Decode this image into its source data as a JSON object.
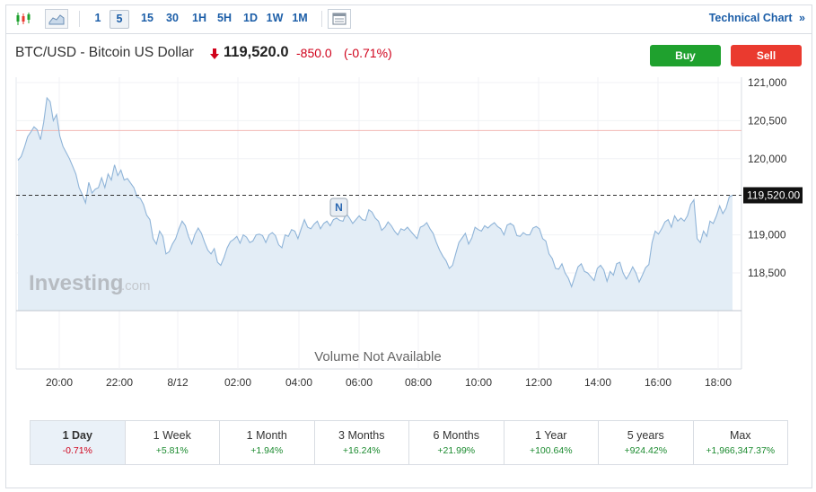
{
  "toolbar": {
    "chart_type_icon": "candlestick-icon",
    "area_icon": "area-chart-icon",
    "timeframes": [
      "1",
      "5",
      "15",
      "30",
      "1H",
      "5H",
      "1D",
      "1W",
      "1M"
    ],
    "active_timeframe": "5",
    "calendar_icon": "calendar-icon",
    "technical_chart": "Technical Chart",
    "technical_chart_arrow": "»"
  },
  "header": {
    "title": "BTC/USD - Bitcoin US Dollar",
    "price": "119,520.0",
    "change": "-850.0",
    "change_pct": "(-0.71%)",
    "direction_icon": "down-arrow-icon",
    "buy_label": "Buy",
    "sell_label": "Sell",
    "colors": {
      "buy": "#1fa12e",
      "sell": "#ea3a2f",
      "down": "#d0021b",
      "up": "#1a8a2e"
    }
  },
  "chart_data": {
    "type": "area",
    "y_ticks": [
      "121,000",
      "120,500",
      "120,000",
      "119,000",
      "118,500"
    ],
    "ylim": [
      118000,
      121200
    ],
    "x_ticks": [
      "20:00",
      "22:00",
      "8/12",
      "02:00",
      "04:00",
      "06:00",
      "08:00",
      "10:00",
      "12:00",
      "14:00",
      "16:00",
      "18:00"
    ],
    "current_price_label": "119,520.00",
    "current_price": 119520,
    "previous_close": 120370,
    "news_marker": "N",
    "watermark": "Investing",
    "watermark_suffix": ".com",
    "volume_text": "Volume Not Available",
    "series": [
      {
        "values": [
          119980,
          120030,
          120150,
          120290,
          120350,
          120420,
          120380,
          120250,
          120480,
          120800,
          120750,
          120500,
          120580,
          120300,
          120160,
          120080,
          120000,
          119900,
          119800,
          119620,
          119530,
          119420,
          119690,
          119550,
          119600,
          119620,
          119750,
          119620,
          119800,
          119720,
          119920,
          119780,
          119850,
          119720,
          119740,
          119680,
          119620,
          119500,
          119480,
          119400,
          119260,
          119200,
          118950,
          118880,
          119050,
          118980,
          118750,
          118780,
          118880,
          118950,
          119080,
          119180,
          119120,
          118980,
          118880,
          119010,
          119090,
          119020,
          118900,
          118800,
          118750,
          118820,
          118640,
          118600,
          118700,
          118830,
          118910,
          118940,
          118980,
          118890,
          119000,
          118970,
          118900,
          118920,
          119000,
          119010,
          118990,
          118900,
          119000,
          119030,
          118990,
          118870,
          118830,
          119000,
          118980,
          119070,
          119050,
          118950,
          119080,
          119200,
          119100,
          119080,
          119140,
          119180,
          119080,
          119150,
          119180,
          119120,
          119200,
          119220,
          119190,
          119180,
          119280,
          119220,
          119150,
          119200,
          119250,
          119200,
          119190,
          119330,
          119300,
          119220,
          119180,
          119060,
          119100,
          119170,
          119120,
          119050,
          119000,
          119080,
          119060,
          119100,
          119050,
          119000,
          118950,
          119100,
          119120,
          119160,
          119080,
          119020,
          118900,
          118800,
          118720,
          118660,
          118560,
          118600,
          118750,
          118900,
          118960,
          119020,
          118880,
          118960,
          119100,
          119070,
          119050,
          119120,
          119090,
          119130,
          119160,
          119110,
          119080,
          119000,
          119130,
          119150,
          119120,
          118990,
          118980,
          119030,
          119000,
          119000,
          119090,
          119110,
          119080,
          118950,
          118920,
          118750,
          118690,
          118560,
          118550,
          118620,
          118500,
          118430,
          118320,
          118450,
          118580,
          118620,
          118520,
          118500,
          118450,
          118400,
          118560,
          118600,
          118540,
          118390,
          118520,
          118470,
          118620,
          118640,
          118500,
          118420,
          118490,
          118580,
          118500,
          118380,
          118470,
          118570,
          118610,
          118900,
          119050,
          119010,
          119080,
          119170,
          119200,
          119100,
          119250,
          119180,
          119220,
          119180,
          119250,
          119400,
          119460,
          118950,
          118900,
          119050,
          118980,
          119180,
          119150,
          119250,
          119380,
          119280,
          119350,
          119500,
          119520
        ]
      }
    ]
  },
  "periods": [
    {
      "label": "1 Day",
      "pct": "-0.71%",
      "dir": "neg",
      "active": true
    },
    {
      "label": "1 Week",
      "pct": "+5.81%",
      "dir": "pos",
      "active": false
    },
    {
      "label": "1 Month",
      "pct": "+1.94%",
      "dir": "pos",
      "active": false
    },
    {
      "label": "3 Months",
      "pct": "+16.24%",
      "dir": "pos",
      "active": false
    },
    {
      "label": "6 Months",
      "pct": "+21.99%",
      "dir": "pos",
      "active": false
    },
    {
      "label": "1 Year",
      "pct": "+100.64%",
      "dir": "pos",
      "active": false
    },
    {
      "label": "5 years",
      "pct": "+924.42%",
      "dir": "pos",
      "active": false
    },
    {
      "label": "Max",
      "pct": "+1,966,347.37%",
      "dir": "pos",
      "active": false
    }
  ]
}
